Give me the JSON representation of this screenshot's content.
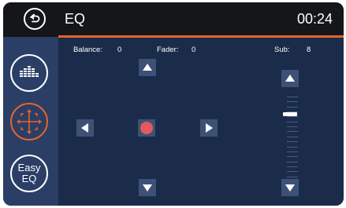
{
  "header": {
    "title": "EQ",
    "time": "00:24"
  },
  "icons": {
    "back": "back-arrow-icon",
    "eq_bars": "equalizer-bars-icon",
    "balance_fader": "balance-fader-icon",
    "easy_eq_text": "Easy EQ"
  },
  "sidebar": {
    "easy_eq_line1": "Easy",
    "easy_eq_line2": "EQ"
  },
  "controls": {
    "balance_label": "Balance:",
    "balance_value": "0",
    "fader_label": "Fader:",
    "fader_value": "0",
    "sub_label": "Sub:",
    "sub_value": "8",
    "sub_level_fraction": 0.8
  },
  "colors": {
    "accent": "#e4642a",
    "dot": "#e25b5b",
    "panel": "#1a2c4a",
    "sidebar": "#2a3e66"
  }
}
